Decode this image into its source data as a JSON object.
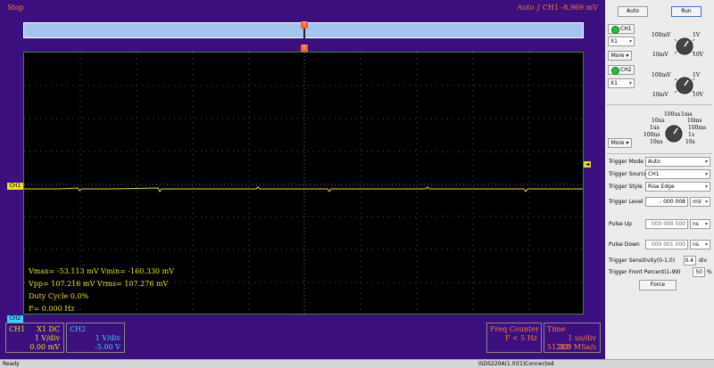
{
  "scope": {
    "state": "Stop",
    "trigger_mode_display": "Auto",
    "trigger_icon": "rising-edge-icon",
    "trigger_channel": "CH1",
    "trigger_value": "-8.969 mV",
    "overview_marker": "T",
    "screen_marker": "T",
    "ch1_tag": "CH1",
    "ch2_tag": "CH2",
    "trigger_right_tag": "◄",
    "colors": {
      "ch1": "#e8e020",
      "ch2": "#3ad0ff",
      "accent": "#ff7a3a",
      "screen": "#000000",
      "frame": "#3b0f7d"
    }
  },
  "measurements": {
    "vmax_min": "Vmax= -53.113 mV  Vmin= -160.330 mV",
    "vpp_vrms": "Vpp= 107.216 mV  Vrms= 107.276 mV",
    "duty": "Duty Cycle 0.0%",
    "freq": "F= 0.000 Hz"
  },
  "ch1_box": {
    "name": "CH1",
    "coupling": "X1  DC",
    "scale": "1 V/div",
    "offset": "0.00 mV"
  },
  "ch2_box": {
    "name": "CH2",
    "scale": "1 V/div",
    "offset": "-5.00 V"
  },
  "freq_counter": {
    "title": "Freq Counter",
    "value": "F < 5 Hz"
  },
  "time_box": {
    "title": "Time",
    "scale": "1 us/div",
    "memory": "512KB",
    "rate": "200 MSa/s"
  },
  "panel": {
    "auto_label": "Auto",
    "run_label": "Run",
    "ch1": {
      "label": "CH1",
      "probe": "X1",
      "more": "More",
      "knob": [
        "100mV",
        "1V",
        "10mV",
        "10V"
      ]
    },
    "ch2": {
      "label": "CH2",
      "probe": "X1",
      "knob": [
        "100mV",
        "1V",
        "10mV",
        "10V"
      ]
    },
    "time": {
      "more": "More",
      "knob": [
        "100us",
        "1ms",
        "10us",
        "10ms",
        "1us",
        "100ms",
        "100ns",
        "1s",
        "10ns",
        "10s"
      ]
    },
    "trigger_mode": {
      "label": "Trigger Mode",
      "value": "Auto"
    },
    "trigger_source": {
      "label": "Trigger Source",
      "value": "CH1"
    },
    "trigger_style": {
      "label": "Trigger Style",
      "value": "Rise Edge"
    },
    "trigger_level": {
      "label": "Trigger Level",
      "value": "- 000 008",
      "unit": "mV"
    },
    "pulse_up": {
      "label": "Pulse Up",
      "value": "000 000 500",
      "unit": "ns"
    },
    "pulse_down": {
      "label": "Pulse Down",
      "value": "000 001 000",
      "unit": "ns"
    },
    "sensitivity": {
      "label": "Trigger Sensitivity(0-1.0)",
      "value": "0.4",
      "unit": "div"
    },
    "front_percent": {
      "label": "Trigger Front Percent(1-99)",
      "value": "50",
      "unit": "%"
    },
    "force_label": "Force"
  },
  "statusbar": {
    "left": "Ready",
    "center": "ISDS220A(1.0)(1)Connected"
  }
}
